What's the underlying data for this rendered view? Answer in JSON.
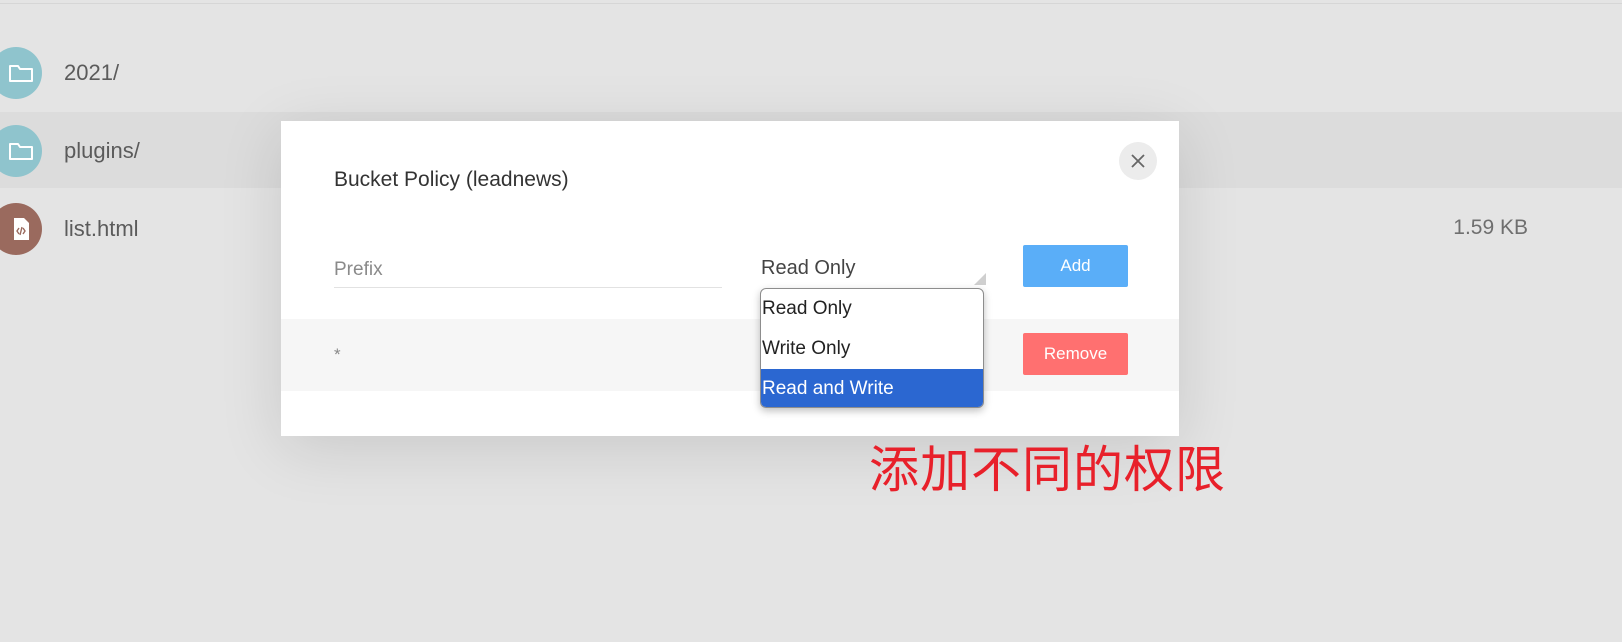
{
  "file_list": [
    {
      "name": "2021/",
      "type": "folder",
      "icon": "folder-icon",
      "size": ""
    },
    {
      "name": "plugins/",
      "type": "folder",
      "icon": "folder-icon",
      "size": ""
    },
    {
      "name": "list.html",
      "type": "file",
      "icon": "html-file-icon",
      "size": "1.59 KB"
    }
  ],
  "modal": {
    "title": "Bucket Policy (leadnews)",
    "close_icon": "close-icon",
    "prefix_placeholder": "Prefix",
    "policy_selected": "Read Only",
    "add_label": "Add",
    "policies": [
      {
        "prefix": "*",
        "remove_label": "Remove"
      }
    ]
  },
  "dropdown": {
    "options": [
      "Read Only",
      "Write Only",
      "Read and Write"
    ],
    "highlighted": "Read and Write"
  },
  "annotation": "添加不同的权限",
  "colors": {
    "folder_icon_bg": "#8fc4cd",
    "html_icon_bg": "#9a6a5e",
    "add_button": "#5aaef8",
    "remove_button": "#ff7070",
    "dropdown_highlight": "#2b67d1",
    "annotation_text": "#e8202a"
  }
}
